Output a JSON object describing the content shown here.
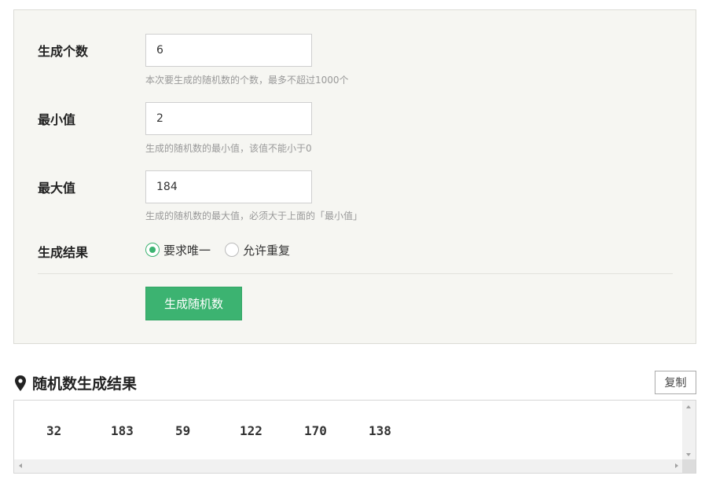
{
  "form": {
    "count": {
      "label": "生成个数",
      "value": "6",
      "hint": "本次要生成的随机数的个数，最多不超过1000个"
    },
    "min": {
      "label": "最小值",
      "value": "2",
      "hint": "生成的随机数的最小值，该值不能小于0"
    },
    "max": {
      "label": "最大值",
      "value": "184",
      "hint": "生成的随机数的最大值，必须大于上面的「最小值」"
    },
    "result_mode": {
      "label": "生成结果",
      "options": [
        {
          "label": "要求唯一",
          "checked": true
        },
        {
          "label": "允许重复",
          "checked": false
        }
      ]
    },
    "generate_label": "生成随机数"
  },
  "result": {
    "title": "随机数生成结果",
    "copy_label": "复制",
    "numbers": [
      "32",
      "183",
      "59",
      "122",
      "170",
      "138"
    ]
  },
  "colors": {
    "accent": "#3cb371",
    "panel_bg": "#f6f6f2"
  },
  "icons": {
    "result_title_icon": "map-pin-icon"
  }
}
